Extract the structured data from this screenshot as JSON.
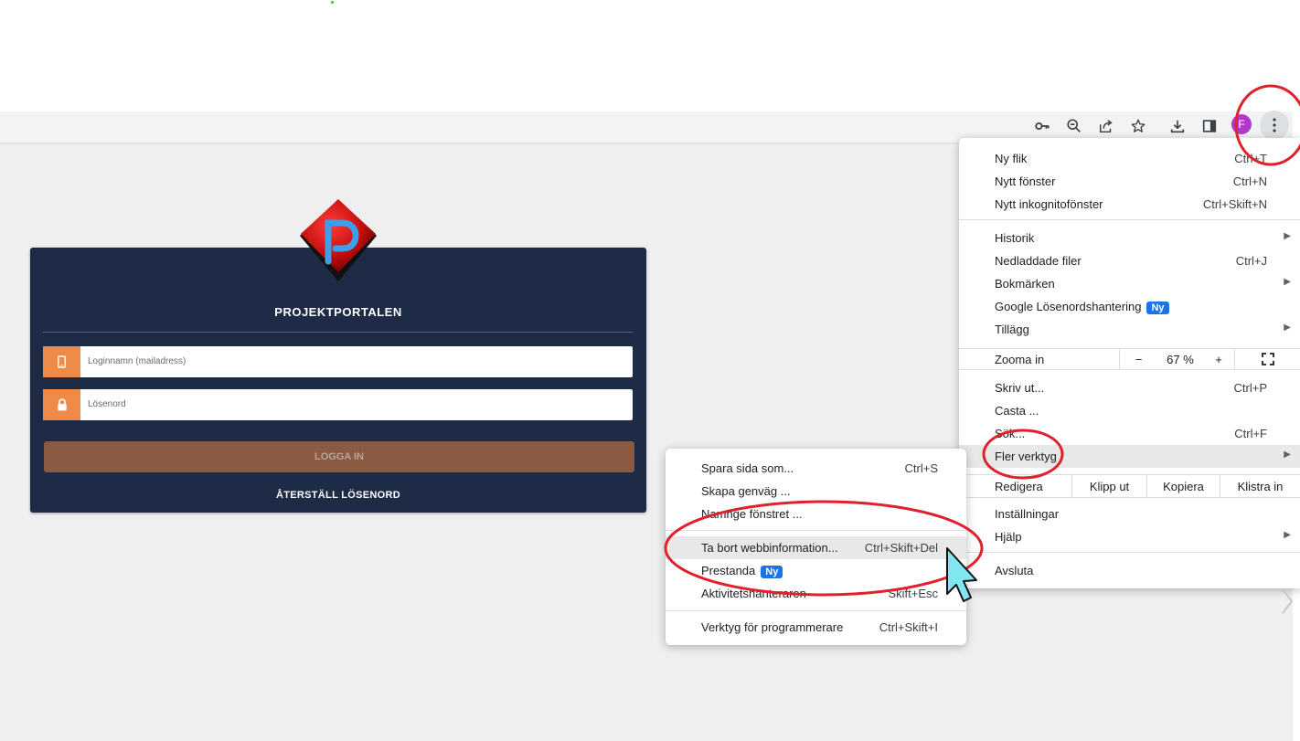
{
  "toolbar": {
    "icons": [
      "key-icon",
      "zoom-icon",
      "share-icon",
      "star-icon",
      "download-icon",
      "side-panel-icon"
    ],
    "profile_initial": "F",
    "profile_color": "#b138c9"
  },
  "login": {
    "title": "PROJEKTPORTALEN",
    "username_placeholder": "Loginnamn (mailadress)",
    "password_placeholder": "Lösenord",
    "login_button": "LOGGA IN",
    "reset_link": "ÅTERSTÄLL LÖSENORD",
    "card_color": "#1d2b46",
    "accent_color": "#ef8a49",
    "button_color": "#8a5a42"
  },
  "chrome_menu": {
    "new_tab": {
      "label": "Ny flik",
      "shortcut": "Ctrl+T"
    },
    "new_window": {
      "label": "Nytt fönster",
      "shortcut": "Ctrl+N"
    },
    "incognito": {
      "label": "Nytt inkognitofönster",
      "shortcut": "Ctrl+Skift+N"
    },
    "history": {
      "label": "Historik"
    },
    "downloads": {
      "label": "Nedladdade filer",
      "shortcut": "Ctrl+J"
    },
    "bookmarks": {
      "label": "Bokmärken"
    },
    "password_manager": {
      "label": "Google Lösenordshantering",
      "badge": "Ny"
    },
    "extensions": {
      "label": "Tillägg"
    },
    "zoom": {
      "label": "Zooma in",
      "minus": "−",
      "value": "67 %",
      "plus": "+"
    },
    "print": {
      "label": "Skriv ut...",
      "shortcut": "Ctrl+P"
    },
    "cast": {
      "label": "Casta ..."
    },
    "find": {
      "label": "Sök...",
      "shortcut": "Ctrl+F"
    },
    "more_tools": {
      "label": "Fler verktyg"
    },
    "edit": {
      "label": "Redigera",
      "cut": "Klipp ut",
      "copy": "Kopiera",
      "paste": "Klistra in"
    },
    "settings": {
      "label": "Inställningar"
    },
    "help": {
      "label": "Hjälp"
    },
    "exit": {
      "label": "Avsluta"
    }
  },
  "submenu": {
    "save_page": {
      "label": "Spara sida som...",
      "shortcut": "Ctrl+S"
    },
    "create_shortcut": {
      "label": "Skapa genväg ..."
    },
    "name_window": {
      "label": "Namnge fönstret ..."
    },
    "clear_data": {
      "label": "Ta bort webbinformation...",
      "shortcut": "Ctrl+Skift+Del"
    },
    "performance": {
      "label": "Prestanda",
      "badge": "Ny"
    },
    "task_manager": {
      "label": "Aktivitetshanteraren",
      "shortcut": "Skift+Esc"
    },
    "dev_tools": {
      "label": "Verktyg för programmerare",
      "shortcut": "Ctrl+Skift+I"
    }
  },
  "annotation_color": "#e0202a",
  "cursor_color": "#7fe6f2"
}
